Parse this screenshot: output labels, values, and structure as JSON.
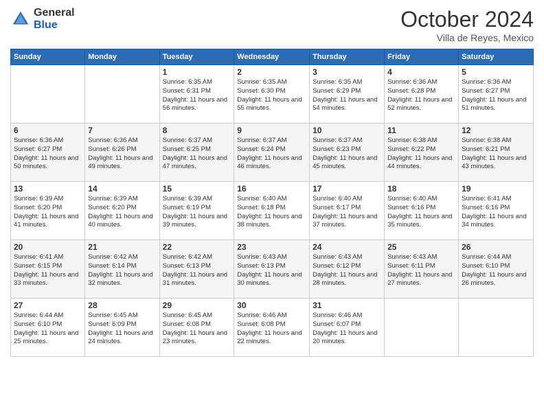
{
  "logo": {
    "general": "General",
    "blue": "Blue"
  },
  "title": "October 2024",
  "subtitle": "Villa de Reyes, Mexico",
  "headers": [
    "Sunday",
    "Monday",
    "Tuesday",
    "Wednesday",
    "Thursday",
    "Friday",
    "Saturday"
  ],
  "weeks": [
    [
      {
        "day": "",
        "info": ""
      },
      {
        "day": "",
        "info": ""
      },
      {
        "day": "1",
        "info": "Sunrise: 6:35 AM\nSunset: 6:31 PM\nDaylight: 11 hours and 56 minutes."
      },
      {
        "day": "2",
        "info": "Sunrise: 6:35 AM\nSunset: 6:30 PM\nDaylight: 11 hours and 55 minutes."
      },
      {
        "day": "3",
        "info": "Sunrise: 6:35 AM\nSunset: 6:29 PM\nDaylight: 11 hours and 54 minutes."
      },
      {
        "day": "4",
        "info": "Sunrise: 6:36 AM\nSunset: 6:28 PM\nDaylight: 11 hours and 52 minutes."
      },
      {
        "day": "5",
        "info": "Sunrise: 6:36 AM\nSunset: 6:27 PM\nDaylight: 11 hours and 51 minutes."
      }
    ],
    [
      {
        "day": "6",
        "info": "Sunrise: 6:36 AM\nSunset: 6:27 PM\nDaylight: 11 hours and 50 minutes."
      },
      {
        "day": "7",
        "info": "Sunrise: 6:36 AM\nSunset: 6:26 PM\nDaylight: 11 hours and 49 minutes."
      },
      {
        "day": "8",
        "info": "Sunrise: 6:37 AM\nSunset: 6:25 PM\nDaylight: 11 hours and 47 minutes."
      },
      {
        "day": "9",
        "info": "Sunrise: 6:37 AM\nSunset: 6:24 PM\nDaylight: 11 hours and 46 minutes."
      },
      {
        "day": "10",
        "info": "Sunrise: 6:37 AM\nSunset: 6:23 PM\nDaylight: 11 hours and 45 minutes."
      },
      {
        "day": "11",
        "info": "Sunrise: 6:38 AM\nSunset: 6:22 PM\nDaylight: 11 hours and 44 minutes."
      },
      {
        "day": "12",
        "info": "Sunrise: 6:38 AM\nSunset: 6:21 PM\nDaylight: 11 hours and 43 minutes."
      }
    ],
    [
      {
        "day": "13",
        "info": "Sunrise: 6:39 AM\nSunset: 6:20 PM\nDaylight: 11 hours and 41 minutes."
      },
      {
        "day": "14",
        "info": "Sunrise: 6:39 AM\nSunset: 6:20 PM\nDaylight: 11 hours and 40 minutes."
      },
      {
        "day": "15",
        "info": "Sunrise: 6:39 AM\nSunset: 6:19 PM\nDaylight: 11 hours and 39 minutes."
      },
      {
        "day": "16",
        "info": "Sunrise: 6:40 AM\nSunset: 6:18 PM\nDaylight: 11 hours and 38 minutes."
      },
      {
        "day": "17",
        "info": "Sunrise: 6:40 AM\nSunset: 6:17 PM\nDaylight: 11 hours and 37 minutes."
      },
      {
        "day": "18",
        "info": "Sunrise: 6:40 AM\nSunset: 6:16 PM\nDaylight: 11 hours and 35 minutes."
      },
      {
        "day": "19",
        "info": "Sunrise: 6:41 AM\nSunset: 6:16 PM\nDaylight: 11 hours and 34 minutes."
      }
    ],
    [
      {
        "day": "20",
        "info": "Sunrise: 6:41 AM\nSunset: 6:15 PM\nDaylight: 11 hours and 33 minutes."
      },
      {
        "day": "21",
        "info": "Sunrise: 6:42 AM\nSunset: 6:14 PM\nDaylight: 11 hours and 32 minutes."
      },
      {
        "day": "22",
        "info": "Sunrise: 6:42 AM\nSunset: 6:13 PM\nDaylight: 11 hours and 31 minutes."
      },
      {
        "day": "23",
        "info": "Sunrise: 6:43 AM\nSunset: 6:13 PM\nDaylight: 11 hours and 30 minutes."
      },
      {
        "day": "24",
        "info": "Sunrise: 6:43 AM\nSunset: 6:12 PM\nDaylight: 11 hours and 28 minutes."
      },
      {
        "day": "25",
        "info": "Sunrise: 6:43 AM\nSunset: 6:11 PM\nDaylight: 11 hours and 27 minutes."
      },
      {
        "day": "26",
        "info": "Sunrise: 6:44 AM\nSunset: 6:10 PM\nDaylight: 11 hours and 26 minutes."
      }
    ],
    [
      {
        "day": "27",
        "info": "Sunrise: 6:44 AM\nSunset: 6:10 PM\nDaylight: 11 hours and 25 minutes."
      },
      {
        "day": "28",
        "info": "Sunrise: 6:45 AM\nSunset: 6:09 PM\nDaylight: 11 hours and 24 minutes."
      },
      {
        "day": "29",
        "info": "Sunrise: 6:45 AM\nSunset: 6:08 PM\nDaylight: 11 hours and 23 minutes."
      },
      {
        "day": "30",
        "info": "Sunrise: 6:46 AM\nSunset: 6:08 PM\nDaylight: 11 hours and 22 minutes."
      },
      {
        "day": "31",
        "info": "Sunrise: 6:46 AM\nSunset: 6:07 PM\nDaylight: 11 hours and 20 minutes."
      },
      {
        "day": "",
        "info": ""
      },
      {
        "day": "",
        "info": ""
      }
    ]
  ]
}
